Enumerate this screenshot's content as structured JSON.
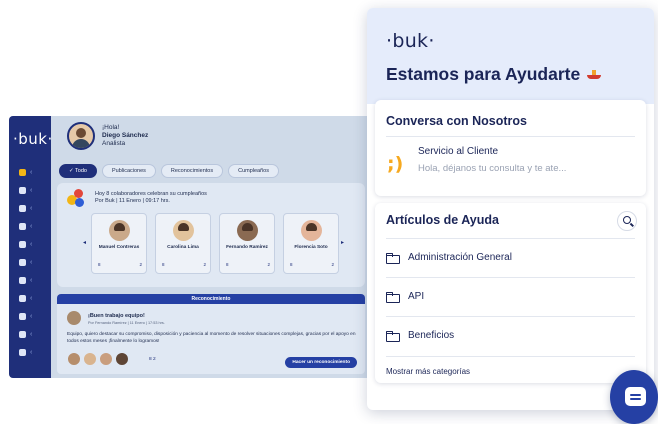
{
  "app": {
    "logo": "·buk·",
    "profile": {
      "greeting": "¡Hola!",
      "name": "Diego Sánchez",
      "role": "Analista"
    },
    "tabs": [
      {
        "label": "✓ Todo",
        "selected": true
      },
      {
        "label": "Publicaciones"
      },
      {
        "label": "Reconocimientos"
      },
      {
        "label": "Cumpleaños"
      }
    ],
    "birthday": {
      "headline": "Hoy 8 colaboradores celebran su cumpleaños",
      "meta": "Por Buk | 11 Enero | 09:17 hrs.",
      "people": [
        {
          "name": "Manuel Contreras",
          "likes": "8",
          "comments": "2"
        },
        {
          "name": "Carolina Lima",
          "likes": "8",
          "comments": "2"
        },
        {
          "name": "Fernando Ramírez",
          "likes": "8",
          "comments": "2"
        },
        {
          "name": "Florencia Soto",
          "likes": "8",
          "comments": "2"
        }
      ]
    },
    "recognition": {
      "bar_label": "Reconocimiento",
      "title": "¡Buen trabajo equipo!",
      "meta": "Por Fernando Ramírez | 11 Enero | 17:53 hrs.",
      "body": "Equipo, quiero destacar su compromiso, disposición y paciencia al momento de resolver situaciones complejas, gracias por el apoyo en todos estos meses ¡finalmente lo logramos!",
      "counts": "8 2",
      "button": "Hacer un reconocimiento"
    }
  },
  "panel": {
    "logo": "·buk·",
    "title": "Estamos para Ayudarte",
    "chat": {
      "title": "Conversa con Nosotros",
      "service_title": "Servicio al Cliente",
      "service_subtitle": "Hola, déjanos tu consulta y te ate..."
    },
    "articles": {
      "title": "Artículos de Ayuda",
      "items": [
        "Administración General",
        "API",
        "Beneficios"
      ],
      "more": "Mostrar más categorías"
    }
  },
  "colors": {
    "navy": "#1b2557",
    "brand_blue": "#2540a4",
    "accent_yellow": "#f6a920",
    "header_bg": "#e5ecfb"
  }
}
